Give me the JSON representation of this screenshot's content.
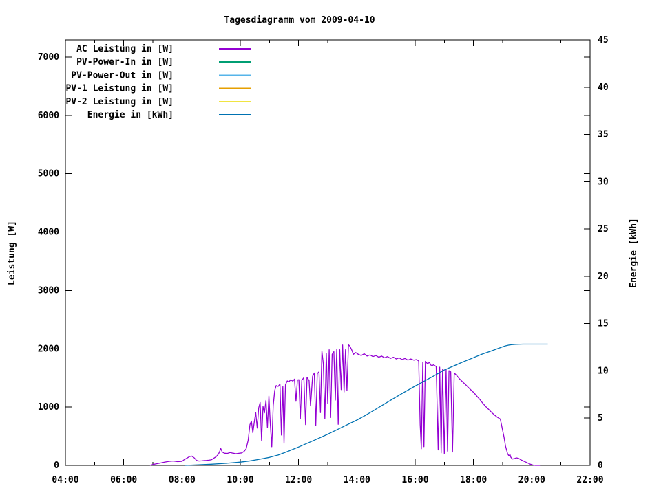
{
  "title": "Tagesdiagramm vom 2009-04-10",
  "chart_data": {
    "type": "line",
    "title": "Tagesdiagramm vom 2009-04-10",
    "grid": false,
    "legend_position": "top-left-inside",
    "x_axis": {
      "label": "",
      "unit": "time",
      "range_hours": [
        4,
        22
      ],
      "major_ticks": [
        {
          "hour": 4,
          "label": "04:00"
        },
        {
          "hour": 6,
          "label": "06:00"
        },
        {
          "hour": 8,
          "label": "08:00"
        },
        {
          "hour": 10,
          "label": "10:00"
        },
        {
          "hour": 12,
          "label": "12:00"
        },
        {
          "hour": 14,
          "label": "14:00"
        },
        {
          "hour": 16,
          "label": "16:00"
        },
        {
          "hour": 18,
          "label": "18:00"
        },
        {
          "hour": 20,
          "label": "20:00"
        },
        {
          "hour": 22,
          "label": "22:00"
        }
      ],
      "minor_tick_hours": [
        5,
        7,
        9,
        11,
        13,
        15,
        17,
        19,
        21
      ]
    },
    "y_axis": {
      "label": "Leistung [W]",
      "range": [
        0,
        7295
      ],
      "ticks": [
        0,
        1000,
        2000,
        3000,
        4000,
        5000,
        6000,
        7000
      ]
    },
    "y2_axis": {
      "label": "Energie [kWh]",
      "range": [
        0,
        45
      ],
      "ticks": [
        0,
        5,
        10,
        15,
        20,
        25,
        30,
        35,
        40,
        45
      ]
    },
    "legend": [
      {
        "id": "ac_leistung",
        "label": "AC Leistung in [W]",
        "color": "#9400d3"
      },
      {
        "id": "pv_power_in",
        "label": "PV-Power-In in [W]",
        "color": "#009e73"
      },
      {
        "id": "pv_power_out",
        "label": "PV-Power-Out in [W]",
        "color": "#56b4e9"
      },
      {
        "id": "pv1_leistung",
        "label": "PV-1 Leistung in [W]",
        "color": "#e69f00"
      },
      {
        "id": "pv2_leistung",
        "label": "PV-2 Leistung in [W]",
        "color": "#f0e442"
      },
      {
        "id": "energie",
        "label": "Energie in [kWh]",
        "color": "#0072b2"
      }
    ],
    "series": [
      {
        "id": "ac_leistung",
        "name": "AC Leistung in [W]",
        "color": "#9400d3",
        "axis": "y",
        "points": [
          [
            6.9,
            0
          ],
          [
            7.0,
            15
          ],
          [
            7.1,
            25
          ],
          [
            7.25,
            40
          ],
          [
            7.4,
            55
          ],
          [
            7.55,
            70
          ],
          [
            7.7,
            75
          ],
          [
            7.85,
            65
          ],
          [
            8.0,
            70
          ],
          [
            8.08,
            100
          ],
          [
            8.17,
            125
          ],
          [
            8.25,
            150
          ],
          [
            8.33,
            160
          ],
          [
            8.42,
            130
          ],
          [
            8.5,
            85
          ],
          [
            8.58,
            75
          ],
          [
            8.67,
            78
          ],
          [
            8.75,
            82
          ],
          [
            8.83,
            85
          ],
          [
            8.92,
            90
          ],
          [
            9.0,
            95
          ],
          [
            9.08,
            120
          ],
          [
            9.17,
            150
          ],
          [
            9.25,
            195
          ],
          [
            9.3,
            250
          ],
          [
            9.33,
            290
          ],
          [
            9.38,
            230
          ],
          [
            9.45,
            210
          ],
          [
            9.55,
            205
          ],
          [
            9.65,
            220
          ],
          [
            9.75,
            210
          ],
          [
            9.85,
            200
          ],
          [
            9.95,
            208
          ],
          [
            10.05,
            215
          ],
          [
            10.13,
            240
          ],
          [
            10.2,
            285
          ],
          [
            10.27,
            430
          ],
          [
            10.33,
            700
          ],
          [
            10.38,
            760
          ],
          [
            10.43,
            560
          ],
          [
            10.48,
            745
          ],
          [
            10.53,
            905
          ],
          [
            10.58,
            640
          ],
          [
            10.63,
            985
          ],
          [
            10.68,
            1080
          ],
          [
            10.73,
            430
          ],
          [
            10.78,
            1010
          ],
          [
            10.83,
            900
          ],
          [
            10.88,
            1115
          ],
          [
            10.93,
            645
          ],
          [
            10.98,
            1190
          ],
          [
            11.03,
            705
          ],
          [
            11.08,
            320
          ],
          [
            11.13,
            1025
          ],
          [
            11.18,
            1285
          ],
          [
            11.23,
            1370
          ],
          [
            11.3,
            1355
          ],
          [
            11.36,
            1395
          ],
          [
            11.41,
            520
          ],
          [
            11.46,
            1350
          ],
          [
            11.5,
            380
          ],
          [
            11.55,
            1385
          ],
          [
            11.61,
            1450
          ],
          [
            11.67,
            1435
          ],
          [
            11.73,
            1470
          ],
          [
            11.8,
            1445
          ],
          [
            11.86,
            1480
          ],
          [
            11.91,
            1100
          ],
          [
            11.96,
            1465
          ],
          [
            12.01,
            1470
          ],
          [
            12.06,
            800
          ],
          [
            12.11,
            1460
          ],
          [
            12.18,
            1505
          ],
          [
            12.24,
            700
          ],
          [
            12.29,
            1510
          ],
          [
            12.36,
            1455
          ],
          [
            12.41,
            1020
          ],
          [
            12.48,
            1530
          ],
          [
            12.54,
            1585
          ],
          [
            12.59,
            680
          ],
          [
            12.64,
            1575
          ],
          [
            12.7,
            1605
          ],
          [
            12.75,
            905
          ],
          [
            12.8,
            1960
          ],
          [
            12.85,
            1740
          ],
          [
            12.9,
            805
          ],
          [
            12.95,
            1925
          ],
          [
            13.0,
            1060
          ],
          [
            13.05,
            1985
          ],
          [
            13.1,
            820
          ],
          [
            13.15,
            1905
          ],
          [
            13.21,
            1950
          ],
          [
            13.26,
            1120
          ],
          [
            13.31,
            1995
          ],
          [
            13.36,
            705
          ],
          [
            13.41,
            1985
          ],
          [
            13.46,
            1300
          ],
          [
            13.51,
            2065
          ],
          [
            13.56,
            1260
          ],
          [
            13.61,
            1985
          ],
          [
            13.66,
            1285
          ],
          [
            13.71,
            2070
          ],
          [
            13.76,
            2045
          ],
          [
            13.82,
            1985
          ],
          [
            13.88,
            1905
          ],
          [
            13.96,
            1935
          ],
          [
            14.05,
            1905
          ],
          [
            14.15,
            1885
          ],
          [
            14.25,
            1915
          ],
          [
            14.35,
            1875
          ],
          [
            14.45,
            1895
          ],
          [
            14.55,
            1865
          ],
          [
            14.65,
            1885
          ],
          [
            14.75,
            1855
          ],
          [
            14.85,
            1875
          ],
          [
            14.95,
            1845
          ],
          [
            15.05,
            1865
          ],
          [
            15.15,
            1835
          ],
          [
            15.25,
            1855
          ],
          [
            15.35,
            1825
          ],
          [
            15.45,
            1845
          ],
          [
            15.55,
            1815
          ],
          [
            15.65,
            1835
          ],
          [
            15.75,
            1805
          ],
          [
            15.85,
            1825
          ],
          [
            15.95,
            1805
          ],
          [
            16.05,
            1815
          ],
          [
            16.12,
            1790
          ],
          [
            16.17,
            700
          ],
          [
            16.21,
            285
          ],
          [
            16.26,
            1765
          ],
          [
            16.3,
            320
          ],
          [
            16.35,
            1785
          ],
          [
            16.42,
            1745
          ],
          [
            16.49,
            1765
          ],
          [
            16.56,
            1705
          ],
          [
            16.63,
            1725
          ],
          [
            16.72,
            1695
          ],
          [
            16.79,
            265
          ],
          [
            16.84,
            1685
          ],
          [
            16.89,
            215
          ],
          [
            16.94,
            1655
          ],
          [
            17.0,
            205
          ],
          [
            17.06,
            1645
          ],
          [
            17.11,
            245
          ],
          [
            17.16,
            1625
          ],
          [
            17.22,
            1605
          ],
          [
            17.28,
            230
          ],
          [
            17.34,
            1585
          ],
          [
            17.42,
            1545
          ],
          [
            17.52,
            1485
          ],
          [
            17.62,
            1435
          ],
          [
            17.72,
            1390
          ],
          [
            17.82,
            1340
          ],
          [
            17.92,
            1290
          ],
          [
            18.02,
            1245
          ],
          [
            18.12,
            1185
          ],
          [
            18.22,
            1130
          ],
          [
            18.32,
            1065
          ],
          [
            18.42,
            1010
          ],
          [
            18.52,
            960
          ],
          [
            18.62,
            910
          ],
          [
            18.72,
            865
          ],
          [
            18.82,
            825
          ],
          [
            18.92,
            795
          ],
          [
            19.0,
            600
          ],
          [
            19.05,
            480
          ],
          [
            19.1,
            330
          ],
          [
            19.17,
            200
          ],
          [
            19.22,
            160
          ],
          [
            19.25,
            190
          ],
          [
            19.28,
            140
          ],
          [
            19.33,
            110
          ],
          [
            19.4,
            115
          ],
          [
            19.47,
            130
          ],
          [
            19.55,
            120
          ],
          [
            19.65,
            90
          ],
          [
            19.8,
            55
          ],
          [
            19.95,
            20
          ],
          [
            20.05,
            5
          ],
          [
            20.12,
            0
          ],
          [
            20.28,
            0
          ]
        ]
      },
      {
        "id": "pv_power_in",
        "name": "PV-Power-In in [W]",
        "color": "#009e73",
        "axis": "y",
        "points": []
      },
      {
        "id": "pv_power_out",
        "name": "PV-Power-Out in [W]",
        "color": "#56b4e9",
        "axis": "y",
        "points": []
      },
      {
        "id": "pv1_leistung",
        "name": "PV-1 Leistung in [W]",
        "color": "#e69f00",
        "axis": "y",
        "points": []
      },
      {
        "id": "pv2_leistung",
        "name": "PV-2 Leistung in [W]",
        "color": "#f0e442",
        "axis": "y",
        "points": []
      },
      {
        "id": "energie",
        "name": "Energie in [kWh]",
        "color": "#0072b2",
        "axis": "y2",
        "points": [
          [
            8.1,
            0.0
          ],
          [
            8.5,
            0.05
          ],
          [
            9.0,
            0.12
          ],
          [
            9.5,
            0.22
          ],
          [
            10.0,
            0.35
          ],
          [
            10.3,
            0.46
          ],
          [
            10.6,
            0.62
          ],
          [
            11.0,
            0.85
          ],
          [
            11.3,
            1.1
          ],
          [
            11.6,
            1.45
          ],
          [
            12.0,
            1.95
          ],
          [
            12.3,
            2.35
          ],
          [
            12.6,
            2.75
          ],
          [
            13.0,
            3.3
          ],
          [
            13.3,
            3.75
          ],
          [
            13.6,
            4.2
          ],
          [
            14.0,
            4.8
          ],
          [
            14.3,
            5.3
          ],
          [
            14.6,
            5.85
          ],
          [
            15.0,
            6.6
          ],
          [
            15.3,
            7.15
          ],
          [
            15.6,
            7.7
          ],
          [
            16.0,
            8.4
          ],
          [
            16.3,
            8.9
          ],
          [
            16.6,
            9.4
          ],
          [
            17.0,
            10.1
          ],
          [
            17.3,
            10.5
          ],
          [
            17.6,
            10.9
          ],
          [
            18.0,
            11.4
          ],
          [
            18.3,
            11.78
          ],
          [
            18.6,
            12.1
          ],
          [
            19.0,
            12.55
          ],
          [
            19.1,
            12.65
          ],
          [
            19.2,
            12.72
          ],
          [
            19.3,
            12.77
          ],
          [
            19.45,
            12.8
          ],
          [
            19.7,
            12.83
          ],
          [
            20.0,
            12.83
          ],
          [
            20.3,
            12.83
          ],
          [
            20.55,
            12.83
          ]
        ]
      }
    ],
    "colors": {
      "background": "#ffffff",
      "border": "#000000",
      "text": "#000000"
    }
  }
}
